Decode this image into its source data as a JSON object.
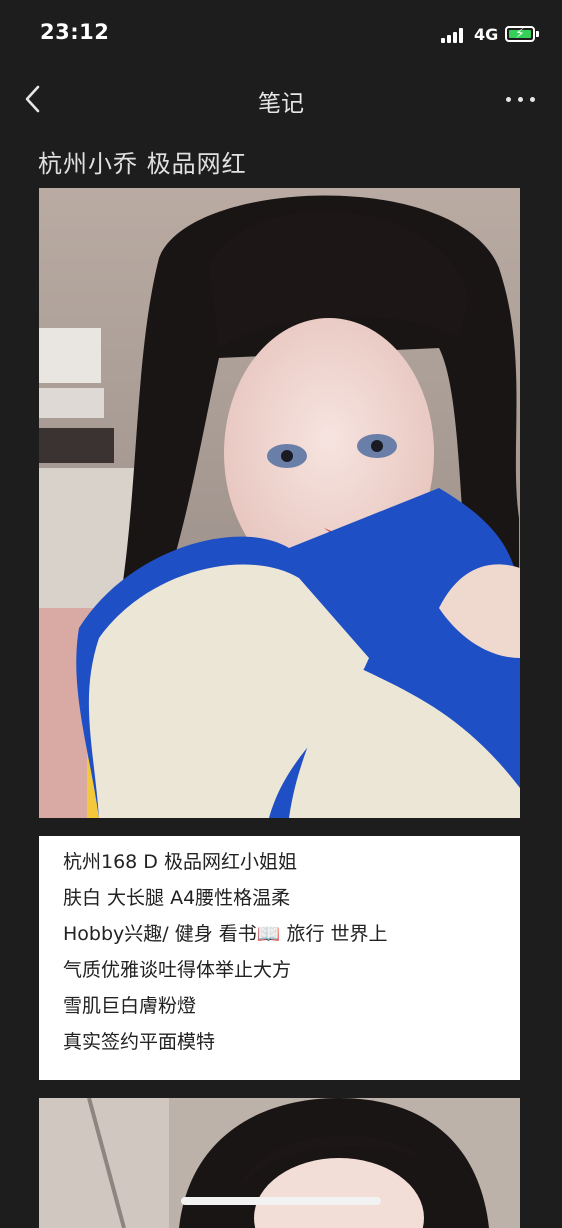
{
  "status_bar": {
    "time": "23:12",
    "network": "4G",
    "battery_bolt": "⚡"
  },
  "nav": {
    "title": "笔记"
  },
  "post": {
    "title": "杭州小乔   极品网红",
    "description_lines": [
      "杭州168  D 极品网红小姐姐",
      "肤白 大长腿 A4腰性格温柔",
      "Hobby兴趣/ 健身  看书📖 旅行 世界上",
      "气质优雅谈吐得体举止大方",
      "雪肌巨白膚粉燈",
      "真实签约平面模特"
    ]
  },
  "colors": {
    "background": "#1d1d1d",
    "battery_fill": "#35d058",
    "jacket_blue": "#1f4fc4",
    "fleece_cream": "#ece6d6"
  }
}
